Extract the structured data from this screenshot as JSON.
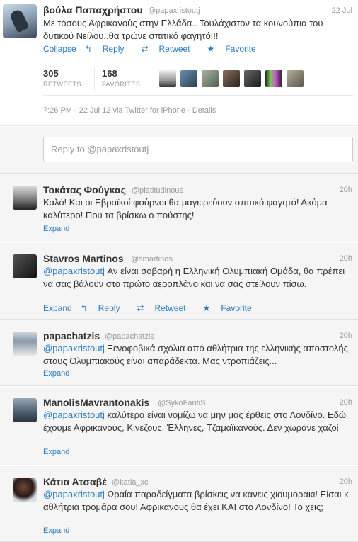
{
  "main_tweet": {
    "name": "βούλα Παπαχρήστου",
    "handle": "@papaxristoutj",
    "time": "22 Jul",
    "text": "Με τόσους Αφρικανούς στην Ελλάδα.. Τουλάχιστον τα κουνούπια του δυτικού Νείλου..θα τρώνε σπιτικό φαγητό!!!",
    "actions": {
      "collapse": "Collapse",
      "reply": "Reply",
      "retweet": "Retweet",
      "favorite": "Favorite"
    },
    "stats": {
      "retweets_count": "305",
      "retweets_label": "RETWEETS",
      "favorites_count": "168",
      "favorites_label": "FAVORITES"
    },
    "meta": "7:26 PM - 22 Jul 12 via Twitter for iPhone · Details"
  },
  "reply_box": {
    "placeholder": "Reply to @papaxristoutj"
  },
  "replies": [
    {
      "name": "Τοκάτας Φούγκας",
      "handle": "@platitudinous",
      "time": "20h",
      "mention": "",
      "text": "Καλό! Και οι Εβραϊκοί φούρνοι θα μαγειρεύουν σπιτικό φαγητό! Ακόμα καλύτερο! Που τα βρίσκω ο πούστης!",
      "expand": "Expand"
    },
    {
      "name": "Stavros Martinos",
      "handle": "@smartinos",
      "time": "20h",
      "mention": "@papaxristoutj",
      "text": " Αν είναι σοβαρή η Ελληνική Ολυμπιακή Ομάδα, θα πρέπει να σας βάλουν στο πρώτο αεροπλάνο και να σας στείλουν πίσω.",
      "expand": "Expand",
      "reply": "Reply",
      "retweet": "Retweet",
      "favorite": "Favorite"
    },
    {
      "name": "papachatzis",
      "handle": "@papachatzis",
      "time": "20h",
      "mention": "@papaxristoutj",
      "text": " Ξενοφοβικά σχόλια από αθλήτρια της ελληνικής αποστολής στους Ολυμπιακούς είναι απαράδεκτα. Μας ντροπιάζεις...",
      "expand": "Expand"
    },
    {
      "name": "ManolisMavrantonakis",
      "handle": "@SykoFantiS",
      "time": "20h",
      "mention": "@papaxristoutj",
      "text": " καλύτερα είναι νομίζω να μην μας έρθεις στο Λονδίνο. Εδώ έχουμε Αφρικανούς, Κινέζους, Έλληνες, Τζαμαϊκανούς. Δεν χωράνε χαζοί",
      "expand": "Expand"
    },
    {
      "name": "Κάτια Ατσαβέ",
      "handle": "@katia_xc",
      "time": "20h",
      "mention": "@papaxristoutj",
      "text": " Ωραία παραδείγματα βρίσκεις να κανεις χιουμορακι! Είσαι κ αθλήτρια τρομάρα σου! Αφρικανους θα έχει ΚΑΙ στο Λονδίνο! Το χεις;",
      "expand": "Expand"
    }
  ]
}
